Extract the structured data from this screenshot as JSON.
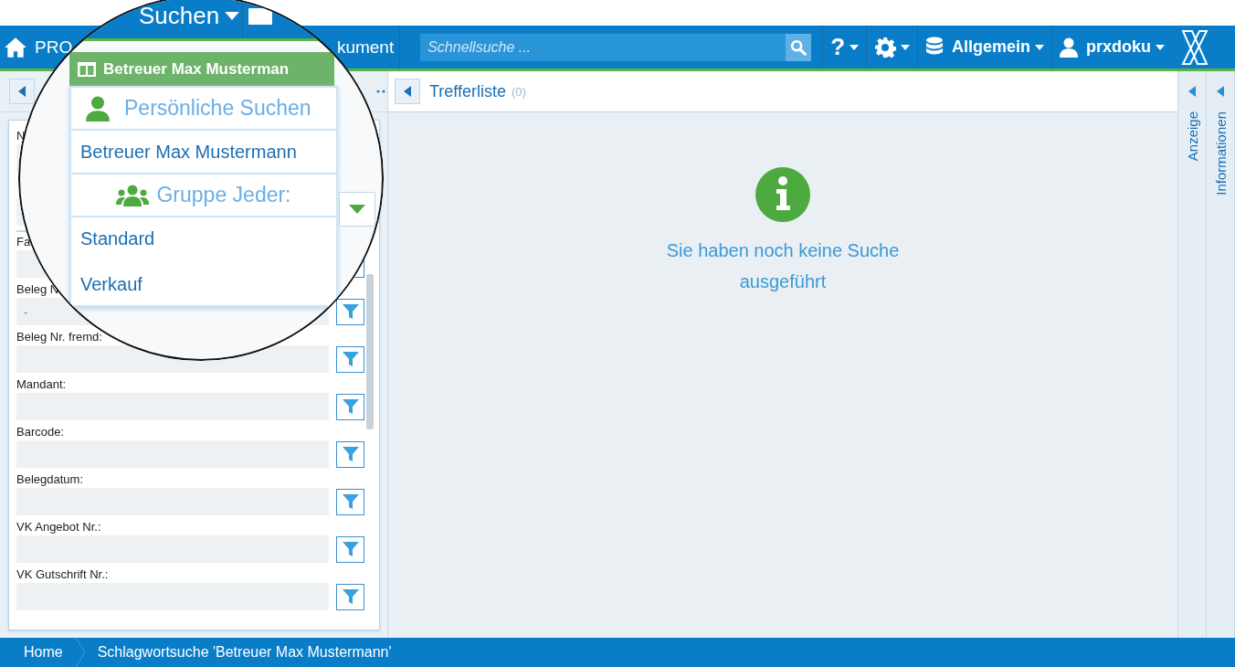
{
  "top_bar": {
    "home_label": "PRO",
    "nav_item": "kument",
    "search": {
      "placeholder": "Schnellsuche ..."
    },
    "menus": [
      {
        "kind": "help",
        "label": "?"
      },
      {
        "kind": "settings"
      },
      {
        "kind": "database",
        "label": "Allgemein"
      },
      {
        "kind": "user",
        "label": "prxdoku"
      }
    ]
  },
  "magnifier": {
    "menu_label": "Suchen",
    "header": "Betreuer Max Musterman",
    "sections": [
      {
        "title": "Persönliche Suchen",
        "items": [
          {
            "label": "Betreuer Max Mustermann"
          }
        ]
      },
      {
        "title": "Gruppe Jeder:",
        "items": [
          {
            "label": "Standard"
          },
          {
            "label": "Verkauf"
          }
        ]
      }
    ]
  },
  "search_form": {
    "fields": [
      {
        "label": "N",
        "kind": "plain"
      },
      {
        "kind": "dropdown"
      },
      {
        "label": "Fa",
        "kind": "button_edge"
      },
      {
        "label": "Beleg N",
        "kind": "filter",
        "value": "-"
      },
      {
        "label": "Beleg Nr. fremd:",
        "kind": "filter"
      },
      {
        "label": "Mandant:",
        "kind": "filter"
      },
      {
        "label": "Barcode:",
        "kind": "filter"
      },
      {
        "label": "Belegdatum:",
        "kind": "filter"
      },
      {
        "label": "VK Angebot Nr.:",
        "kind": "filter"
      },
      {
        "label": "VK Gutschrift Nr.:",
        "kind": "filter"
      }
    ]
  },
  "results": {
    "title": "Trefferliste",
    "count": "(0)",
    "message": "Sie haben noch keine Suche ausgeführt"
  },
  "side_tabs": [
    {
      "label": "Anzeige"
    },
    {
      "label": "Informationen"
    }
  ],
  "breadcrumb": [
    "Home",
    "Schlagwortsuche 'Betreuer Max Mustermann'"
  ]
}
